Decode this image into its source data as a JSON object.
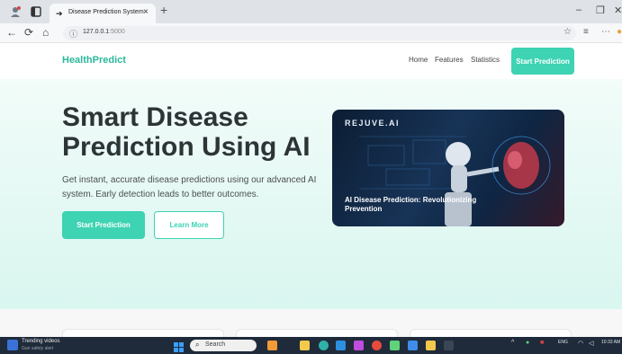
{
  "browser": {
    "tab_title": "Disease Prediction System",
    "tab_close": "×",
    "new_tab": "+",
    "url_host": "127.0.0.1",
    "url_port": ":5000"
  },
  "site": {
    "brand": "HealthPredict",
    "nav": [
      "Home",
      "Features",
      "Statistics"
    ],
    "header_cta": "Start Prediction"
  },
  "hero": {
    "title_line1": "Smart Disease",
    "title_line2": "Prediction Using AI",
    "lead": "Get instant, accurate disease predictions using our advanced AI system. Early detection leads to better outcomes.",
    "primary_button": "Start Prediction",
    "secondary_button": "Learn More",
    "image_brand": "REJUVE.AI",
    "image_caption": "AI Disease Prediction: Revolutionizing Prevention"
  },
  "taskbar": {
    "news_title": "Trending videos",
    "news_sub": "Gun safety alert",
    "search_placeholder": "Search",
    "lang": "ENG",
    "time": "10:33 AM"
  },
  "colors": {
    "accent": "#3dd3b3",
    "brand": "#2bb89a",
    "hero_bg": "#e3f8f2"
  }
}
